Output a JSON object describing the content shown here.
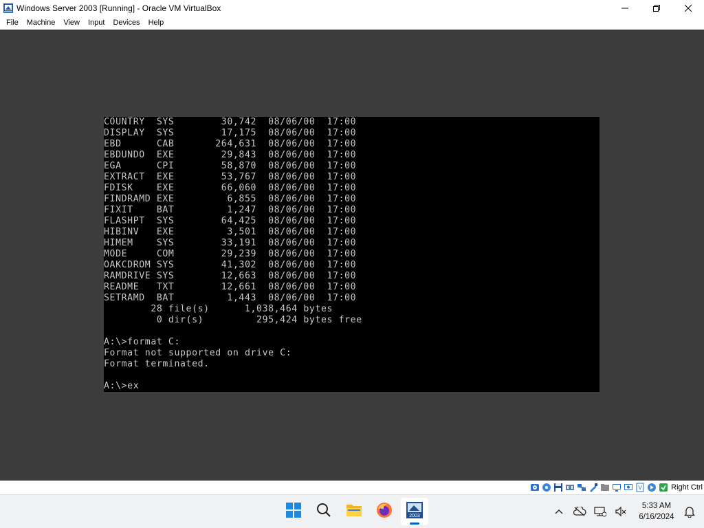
{
  "window": {
    "title": "Windows Server 2003 [Running] - Oracle VM VirtualBox"
  },
  "menu": {
    "items": [
      "File",
      "Machine",
      "View",
      "Input",
      "Devices",
      "Help"
    ]
  },
  "console": {
    "lines": [
      "COUNTRY  SYS        30,742  08/06/00  17:00",
      "DISPLAY  SYS        17,175  08/06/00  17:00",
      "EBD      CAB       264,631  08/06/00  17:00",
      "EBDUNDO  EXE        29,843  08/06/00  17:00",
      "EGA      CPI        58,870  08/06/00  17:00",
      "EXTRACT  EXE        53,767  08/06/00  17:00",
      "FDISK    EXE        66,060  08/06/00  17:00",
      "FINDRAMD EXE         6,855  08/06/00  17:00",
      "FIXIT    BAT         1,247  08/06/00  17:00",
      "FLASHPT  SYS        64,425  08/06/00  17:00",
      "HIBINV   EXE         3,501  08/06/00  17:00",
      "HIMEM    SYS        33,191  08/06/00  17:00",
      "MODE     COM        29,239  08/06/00  17:00",
      "OAKCDROM SYS        41,302  08/06/00  17:00",
      "RAMDRIVE SYS        12,663  08/06/00  17:00",
      "README   TXT        12,661  08/06/00  17:00",
      "SETRAMD  BAT         1,443  08/06/00  17:00",
      "        28 file(s)      1,038,464 bytes",
      "         0 dir(s)         295,424 bytes free",
      "",
      "A:\\>format C:",
      "Format not supported on drive C:",
      "Format terminated.",
      "",
      "A:\\>ex"
    ]
  },
  "statusbar": {
    "host_key": "Right Ctrl",
    "icons": [
      "hard-disk-icon",
      "optical-drive-icon",
      "floppy-icon",
      "audio-icon",
      "network-icon",
      "usb-icon",
      "shared-folders-icon",
      "display-icon",
      "video-capture-icon",
      "virtualization-icon",
      "mouse-integration-icon",
      "keyboard-icon"
    ]
  },
  "taskbar": {
    "apps": [
      "start-icon",
      "search-icon",
      "file-explorer-icon",
      "firefox-icon",
      "virtualbox-vm-icon"
    ],
    "clock": {
      "time": "5:33 AM",
      "date": "6/16/2024"
    }
  },
  "colors": {
    "console_bg": "#000000",
    "console_fg": "#c8c8c8",
    "vm_bg": "#3c3c3c",
    "accent": "#0067c0"
  }
}
